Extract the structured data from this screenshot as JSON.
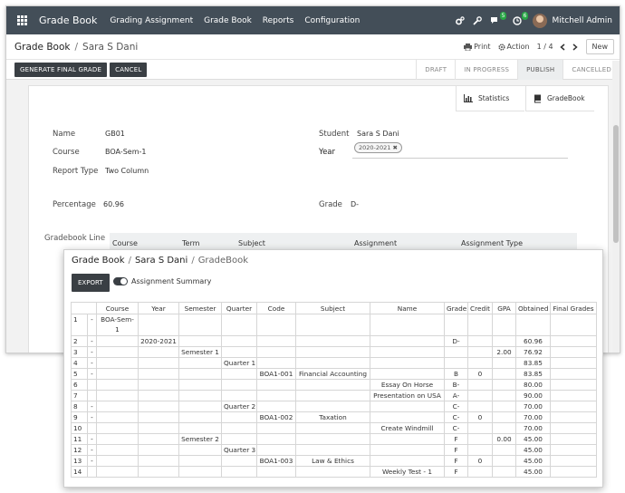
{
  "topbar": {
    "brand": "Grade Book",
    "menu": [
      "Grading Assignment",
      "Grade Book",
      "Reports",
      "Configuration"
    ],
    "chat_badge": "5",
    "activity_badge": "6",
    "user_name": "Mitchell Admin"
  },
  "control_panel": {
    "breadcrumb_root": "Grade Book",
    "breadcrumb_current": "Sara S Dani",
    "print_label": "Print",
    "action_label": "Action",
    "pager": "1 / 4",
    "new_label": "New"
  },
  "statusbar": {
    "generate_label": "GENERATE FINAL GRADE",
    "cancel_label": "CANCEL",
    "stages": [
      "DRAFT",
      "IN PROGRESS",
      "PUBLISH",
      "CANCELLED"
    ],
    "active_stage": "PUBLISH"
  },
  "smart_buttons": {
    "statistics": "Statistics",
    "gradebook": "GradeBook"
  },
  "form": {
    "name_label": "Name",
    "name_value": "GB01",
    "course_label": "Course",
    "course_value": "BOA-Sem-1",
    "report_type_label": "Report Type",
    "report_type_value": "Two Column",
    "percentage_label": "Percentage",
    "percentage_value": "60.96",
    "student_label": "Student",
    "student_value": "Sara S Dani",
    "year_label": "Year",
    "year_tag": "2020-2021",
    "grade_label": "Grade",
    "grade_value": "D-",
    "gradebook_line_label": "Gradebook Line",
    "line_headers": [
      "Course",
      "Term",
      "Subject",
      "Assignment",
      "Assignment Type"
    ]
  },
  "report": {
    "breadcrumb": [
      "Grade Book",
      "Sara S Dani",
      "GradeBook"
    ],
    "export_label": "EXPORT",
    "toggle_label": "Assignment Summary",
    "columns": [
      "",
      "Course",
      "Year",
      "Semester",
      "Quarter",
      "Code",
      "Subject",
      "Name",
      "Grade",
      "Credit",
      "GPA",
      "Obtained",
      "Final Grades"
    ],
    "rows": [
      [
        "1",
        "-",
        "BOA-Sem-1",
        "",
        "",
        "",
        "",
        "",
        "",
        "",
        "",
        "",
        "",
        ""
      ],
      [
        "2",
        "-",
        "",
        "2020-2021",
        "",
        "",
        "",
        "",
        "",
        "D-",
        "",
        "",
        "60.96",
        ""
      ],
      [
        "3",
        "-",
        "",
        "",
        "Semester 1",
        "",
        "",
        "",
        "",
        "",
        "",
        "2.00",
        "76.92",
        ""
      ],
      [
        "4",
        "-",
        "",
        "",
        "",
        "Quarter 1",
        "",
        "",
        "",
        "",
        "",
        "",
        "83.85",
        ""
      ],
      [
        "5",
        "-",
        "",
        "",
        "",
        "",
        "BOA1-001",
        "Financial Accounting",
        "",
        "B",
        "0",
        "",
        "83.85",
        ""
      ],
      [
        "6",
        "",
        "",
        "",
        "",
        "",
        "",
        "",
        "Essay On Horse",
        "B-",
        "",
        "",
        "80.00",
        ""
      ],
      [
        "7",
        "",
        "",
        "",
        "",
        "",
        "",
        "",
        "Presentation on USA",
        "A-",
        "",
        "",
        "90.00",
        ""
      ],
      [
        "8",
        "-",
        "",
        "",
        "",
        "Quarter 2",
        "",
        "",
        "",
        "C-",
        "",
        "",
        "70.00",
        ""
      ],
      [
        "9",
        "-",
        "",
        "",
        "",
        "",
        "BOA1-002",
        "Taxation",
        "",
        "C-",
        "0",
        "",
        "70.00",
        ""
      ],
      [
        "10",
        "",
        "",
        "",
        "",
        "",
        "",
        "",
        "Create Windmill",
        "C-",
        "",
        "",
        "70.00",
        ""
      ],
      [
        "11",
        "-",
        "",
        "",
        "Semester 2",
        "",
        "",
        "",
        "",
        "F",
        "",
        "0.00",
        "45.00",
        ""
      ],
      [
        "12",
        "-",
        "",
        "",
        "",
        "Quarter 3",
        "",
        "",
        "",
        "F",
        "",
        "",
        "45.00",
        ""
      ],
      [
        "13",
        "-",
        "",
        "",
        "",
        "",
        "BOA1-003",
        "Law & Ethics",
        "",
        "F",
        "0",
        "",
        "45.00",
        ""
      ],
      [
        "14",
        "",
        "",
        "",
        "",
        "",
        "",
        "",
        "Weekly Test - 1",
        "F",
        "",
        "",
        "45.00",
        ""
      ]
    ]
  }
}
